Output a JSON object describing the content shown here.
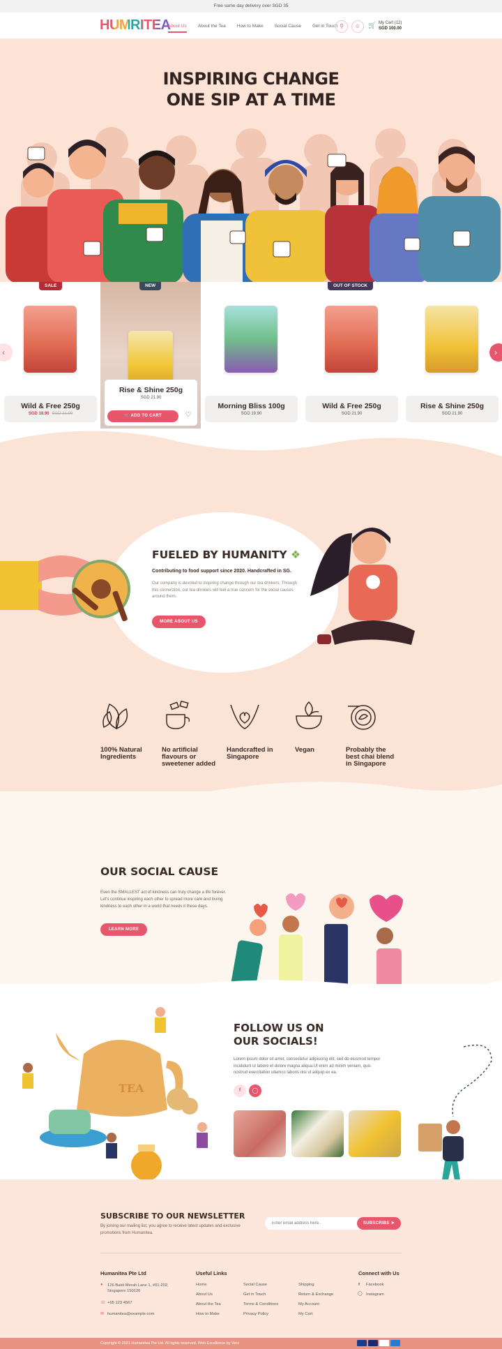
{
  "topbar": {
    "text": "Free same day delivery over SGD 35"
  },
  "header": {
    "logo": "HUMRITEA",
    "nav": [
      "About Us",
      "About the Tea",
      "How to Make",
      "Social Cause",
      "Get in Touch"
    ],
    "icons": [
      "search-icon",
      "user-icon",
      "cart-icon"
    ],
    "cart_label": "My Cart (12)",
    "cart_total": "SGD 100.00"
  },
  "hero": {
    "line1": "INSPIRING CHANGE",
    "line2": "ONE SIP AT A TIME"
  },
  "products": [
    {
      "name": "Wild & Free 250g",
      "price": "SGD 18.90",
      "old_price": "SGD 21.90",
      "badge": "SALE"
    },
    {
      "name": "Rise & Shine 250g",
      "price": "SGD 21.90",
      "badge": "NEW",
      "add_label": "ADD TO CART"
    },
    {
      "name": "Morning Bliss 100g",
      "price": "SGD 19.90"
    },
    {
      "name": "Wild & Free 250g",
      "price": "SGD 21.90",
      "badge": "OUT OF STOCK"
    },
    {
      "name": "Rise & Shine 250g",
      "price": "SGD 21.90"
    }
  ],
  "fueled": {
    "title": "FUELED BY HUMANITY",
    "subtitle": "Contributing to food support since 2020. Handcrafted in SG.",
    "body": "Our company is devoted to inspiring change through our tea drinkers. Through this connection, our tea drinkers will feel a true concern for the social causes around them.",
    "button": "MORE ABOUT US"
  },
  "features": [
    {
      "label": "100% Natural Ingredients",
      "icon": "leaves-icon"
    },
    {
      "label": "No artificial flavours or sweetener added",
      "icon": "teacup-sugar-icon"
    },
    {
      "label": "Handcrafted in Singapore",
      "icon": "hands-heart-icon"
    },
    {
      "label": "Vegan",
      "icon": "vegan-bowl-icon"
    },
    {
      "label": "Probably the best chai blend in Singapore",
      "icon": "tea-leaf-cup-icon"
    }
  ],
  "social_cause": {
    "title": "OUR SOCIAL CAUSE",
    "body": "Even the SMALLEST act of kindness can truly change a life forever. Let's continue inspiring each other to spread more care and loving kindness to each other in a world that needs it these days.",
    "button": "LEARN MORE"
  },
  "follow": {
    "title_line1": "FOLLOW US ON",
    "title_line2": "OUR SOCIALS!",
    "body": "Lorem ipsum dolor sit amet, consectetur adipiscing elit, sed do eiusmod tempor incididunt ut labore et dolore magna aliqua.Ut enim ad minim veniam, quis nostrud exercitation ullamco laboris nisi ut aliquip ex ea."
  },
  "newsletter": {
    "title": "SUBSCRIBE TO OUR NEWSLETTER",
    "body": "By joining our mailing list, you agree to receive latest updates and exclusive promotions from Humanitea.",
    "placeholder": "Enter email address here..",
    "button": "SUBSCRIBE"
  },
  "footer": {
    "company": "Humanitea Pte Ltd",
    "address1": "126 Bukit Merah Lane 1, #01-202,",
    "address2": "Singapore 150126",
    "phone": "+65 123 4567",
    "email": "humanitea@example.com",
    "useful_title": "Useful Links",
    "col1": [
      "Home",
      "About Us",
      "About the Tea",
      "How to Make"
    ],
    "col2": [
      "Social Cause",
      "Get in Touch",
      "Terms & Conditions",
      "Privacy Policy"
    ],
    "col3": [
      "Shipping",
      "Return & Exchange",
      "My Account",
      "My Cart"
    ],
    "connect_title": "Connect with Us",
    "socials": [
      "Facebook",
      "Instagram"
    ],
    "copyright": "Copyright © 2021 Humanitea Pte Ltd. All rights reserved. Web Excellence by Verz"
  },
  "colors": {
    "accent": "#e8566c",
    "peach": "#fbe3d6",
    "dark": "#3a2a24",
    "navy": "#43375a"
  }
}
